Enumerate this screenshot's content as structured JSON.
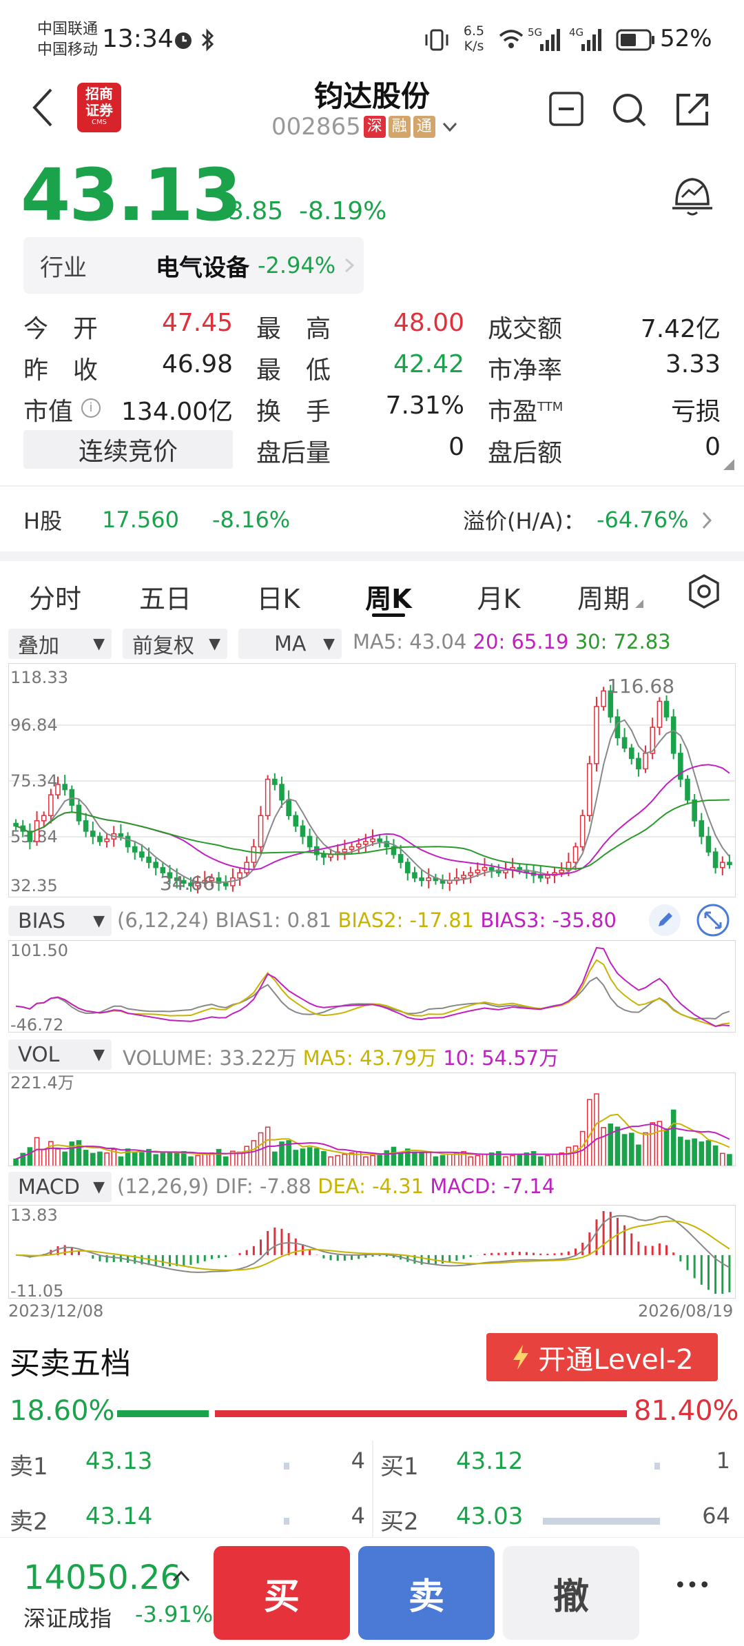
{
  "status_bar": {
    "carrier1": "中国联通",
    "carrier2": "中国移动",
    "time": "13:34",
    "speed_top": "6.5",
    "speed_bottom": "K/s",
    "net1": "5G",
    "net2": "4G",
    "battery": "52%"
  },
  "header": {
    "logo_line1": "招商",
    "logo_line2": "证券",
    "logo_sub": "CMS",
    "title": "钧达股份",
    "code": "002865",
    "tags": [
      "深",
      "融",
      "通"
    ]
  },
  "quote": {
    "price": "43.13",
    "change": "-3.85",
    "change_pct": "-8.19%",
    "industry_label": "行业",
    "industry_name": "电气设备",
    "industry_pct": "-2.94%"
  },
  "stats": [
    {
      "label": "今　开",
      "value": "47.45",
      "color": "red"
    },
    {
      "label": "最　高",
      "value": "48.00",
      "color": "red"
    },
    {
      "label": "成交额",
      "value": "7.42亿",
      "color": "dark"
    },
    {
      "label": "昨　收",
      "value": "46.98",
      "color": "dark"
    },
    {
      "label": "最　低",
      "value": "42.42",
      "color": "green"
    },
    {
      "label": "市净率",
      "value": "3.33",
      "color": "dark"
    },
    {
      "label": "市值",
      "value": "134.00亿",
      "color": "dark"
    },
    {
      "label": "换　手",
      "value": "7.31%",
      "color": "dark"
    },
    {
      "label": "市盈TTM",
      "value": "亏损",
      "color": "dark"
    },
    {
      "label": "连续竞价",
      "value": "",
      "color": "dark"
    },
    {
      "label": "盘后量",
      "value": "0",
      "color": "dark"
    },
    {
      "label": "盘后额",
      "value": "0",
      "color": "dark"
    }
  ],
  "hshare": {
    "label": "H股",
    "price": "17.560",
    "pct": "-8.16%",
    "premium_label": "溢价(H/A)：",
    "premium": "-64.76%"
  },
  "tabs": [
    "分时",
    "五日",
    "日K",
    "周K",
    "月K",
    "周期"
  ],
  "active_tab": 3,
  "chart_controls": {
    "overlay": "叠加",
    "adjust": "前复权",
    "ma": "MA",
    "ma5": "MA5: 43.04",
    "ma20": "20: 65.19",
    "ma30": "30: 72.83"
  },
  "colors": {
    "up": "#e0303b",
    "down": "#1aa34a",
    "ma5": "#888888",
    "ma20": "#c020c0",
    "ma30": "#2a9a2a",
    "yellow": "#c8b400",
    "sell_blue": "#4b7ad6"
  },
  "chart_data": {
    "type": "candlestick",
    "x_start": "2023/12/08",
    "x_end": "2026/08/19",
    "price_axis": [
      "118.33",
      "96.84",
      "75.34",
      "53.84",
      "32.35"
    ],
    "price_ylim": [
      32.35,
      118.33
    ],
    "high_label": "116.68",
    "low_label": "34.66",
    "close": [
      58,
      56,
      52,
      60,
      62,
      70,
      74,
      72,
      66,
      60,
      56,
      54,
      52,
      53,
      55,
      54,
      50,
      48,
      46,
      44,
      42,
      40,
      38,
      37,
      36,
      35,
      36,
      37,
      38,
      36,
      35,
      38,
      40,
      44,
      50,
      62,
      76,
      74,
      68,
      62,
      58,
      54,
      50,
      47,
      46,
      47,
      48,
      49,
      50,
      51,
      52,
      53,
      52,
      50,
      47,
      44,
      40,
      38,
      37,
      38,
      37,
      36,
      37,
      38,
      39,
      40,
      41,
      42,
      41,
      40,
      41,
      42,
      41,
      40,
      39,
      38,
      39,
      40,
      41,
      44,
      50,
      62,
      82,
      104,
      110,
      100,
      92,
      88,
      84,
      80,
      86,
      96,
      106,
      100,
      86,
      76,
      68,
      60,
      54,
      48,
      42,
      44,
      43.13
    ],
    "bias": {
      "label": "BIAS",
      "params": "(6,12,24)",
      "bias1": "BIAS1: 0.81",
      "bias2": "BIAS2: -17.81",
      "bias3": "BIAS3: -35.80",
      "axis_top": "101.50",
      "axis_bottom": "-46.72"
    },
    "volume": {
      "label": "VOL",
      "volume": "VOLUME: 33.22万",
      "ma5": "MA5: 43.79万",
      "ma10": "10: 54.57万",
      "axis_top": "221.4万"
    },
    "macd": {
      "label": "MACD",
      "params": "(12,26,9)",
      "dif": "DIF: -7.88",
      "dea": "DEA: -4.31",
      "macd": "MACD: -7.14",
      "axis_top": "13.83",
      "axis_bottom": "-11.05"
    }
  },
  "order_book": {
    "title": "买卖五档",
    "level2_button": "开通Level-2",
    "buy_ratio": "18.60%",
    "sell_ratio": "81.40%",
    "buy_ratio_value": 18.6,
    "rows": [
      {
        "sell_label": "卖1",
        "sell_price": "43.13",
        "sell_vol": "4",
        "buy_label": "买1",
        "buy_price": "43.12",
        "buy_vol": "1"
      },
      {
        "sell_label": "卖2",
        "sell_price": "43.14",
        "sell_vol": "4",
        "buy_label": "买2",
        "buy_price": "43.03",
        "buy_vol": "64"
      }
    ]
  },
  "bottom_bar": {
    "index_value": "14050.26",
    "index_name": "深证成指",
    "index_pct": "-3.91%",
    "buy": "买",
    "sell": "卖",
    "cancel": "撤",
    "more": "•••"
  }
}
